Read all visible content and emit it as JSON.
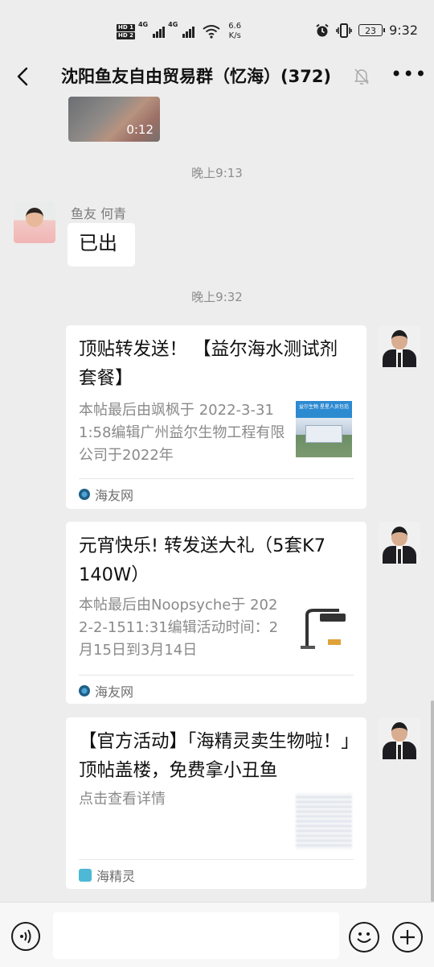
{
  "status_bar": {
    "hd1": "HD 1",
    "hd2": "HD 2",
    "net1": "4G",
    "net2": "4G",
    "speed_value": "6.6",
    "speed_unit": "K/s",
    "battery": "23",
    "time": "9:32"
  },
  "header": {
    "title": "沈阳鱼友自由贸易群（忆海）(372)",
    "back_icon": "back-arrow-icon",
    "mute_icon": "bell-muted-icon",
    "more_icon": "more-dots-icon"
  },
  "chat": {
    "video": {
      "duration": "0:12"
    },
    "time_1": "晚上9:13",
    "message_1": {
      "sender": "鱼友 何青",
      "text": "已出"
    },
    "time_2": "晚上9:32",
    "cards": [
      {
        "title": "顶贴转发送！ 【益尔海水测试剂套餐】",
        "desc": "本帖最后由飒枫于 2022-3-311:58编辑广州益尔生物工程有限公司于2022年",
        "thumb_caption": "益尔生物 星星人员包括",
        "source": "海友网"
      },
      {
        "title": "元宵快乐! 转发送大礼（5套K7 140W）",
        "desc": "本帖最后由Noopsyche于 2022-2-1511:31编辑活动时间：2月15日到3月14日",
        "source": "海友网"
      },
      {
        "title": "【官方活动】「海精灵卖生物啦！」顶帖盖楼，免费拿小丑鱼",
        "desc": "点击查看详情",
        "source": "海精灵"
      }
    ]
  },
  "input_bar": {
    "placeholder": "",
    "voice_icon": "voice-icon",
    "emoji_icon": "emoji-icon",
    "plus_icon": "plus-icon"
  },
  "colors": {
    "background": "#ededed",
    "bubble": "#ffffff",
    "meta_text": "#8d8d8d"
  }
}
